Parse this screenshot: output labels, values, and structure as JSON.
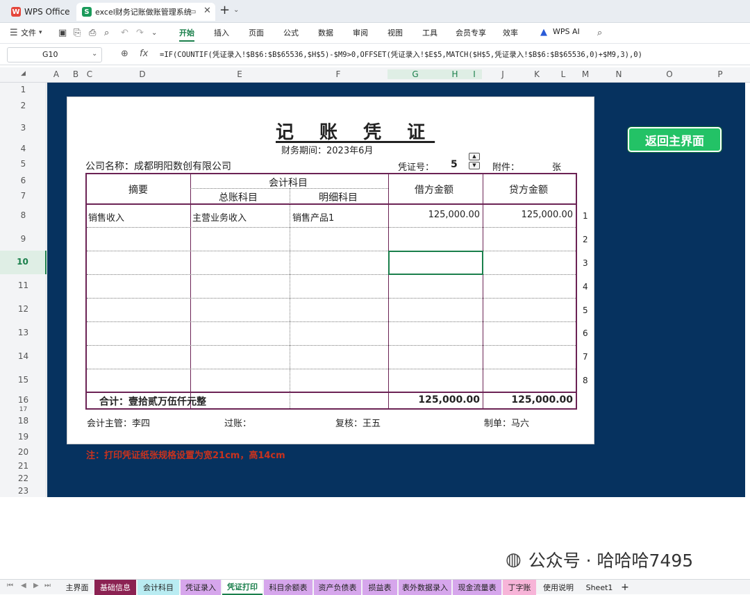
{
  "tabs": {
    "app": "WPS Office",
    "doc": "excel财务记账做账管理系统"
  },
  "menu": {
    "file": "文件",
    "items": [
      "开始",
      "插入",
      "页面",
      "公式",
      "数据",
      "审阅",
      "视图",
      "工具",
      "会员专享",
      "效率",
      "WPS AI"
    ]
  },
  "formula_bar": {
    "cell_ref": "G10",
    "fx": "fx",
    "formula": "=IF(COUNTIF(凭证录入!$B$6:$B$65536,$H$5)-$M9>0,OFFSET(凭证录入!$E$5,MATCH($H$5,凭证录入!$B$6:$B$65536,0)+$M9,3),0)"
  },
  "columns": [
    "A",
    "B",
    "C",
    "D",
    "E",
    "F",
    "G",
    "H",
    "I",
    "J",
    "K",
    "L",
    "M",
    "N",
    "O",
    "P"
  ],
  "rows": [
    "1",
    "2",
    "3",
    "4",
    "5",
    "6",
    "7",
    "8",
    "9",
    "10",
    "11",
    "12",
    "13",
    "14",
    "15",
    "16",
    "17",
    "18",
    "19",
    "20",
    "21",
    "22",
    "23"
  ],
  "voucher": {
    "title": "记 账 凭 证",
    "period": "财务期间：2023年6月",
    "company": "公司名称：成都明阳数创有限公司",
    "voucher_no_label": "凭证号：",
    "voucher_no": "5",
    "attach_label": "附件：",
    "attach_unit": "张",
    "headers": {
      "summary": "摘要",
      "subject": "会计科目",
      "general": "总账科目",
      "detail": "明细科目",
      "debit": "借方金额",
      "credit": "贷方金额"
    },
    "rows": [
      {
        "summary": "销售收入",
        "general": "主营业务收入",
        "detail": "销售产品1",
        "debit": "125,000.00",
        "credit": "125,000.00"
      },
      {
        "summary": "",
        "general": "",
        "detail": "",
        "debit": "",
        "credit": ""
      },
      {
        "summary": "",
        "general": "",
        "detail": "",
        "debit": "",
        "credit": ""
      },
      {
        "summary": "",
        "general": "",
        "detail": "",
        "debit": "",
        "credit": ""
      },
      {
        "summary": "",
        "general": "",
        "detail": "",
        "debit": "",
        "credit": ""
      },
      {
        "summary": "",
        "general": "",
        "detail": "",
        "debit": "",
        "credit": ""
      },
      {
        "summary": "",
        "general": "",
        "detail": "",
        "debit": "",
        "credit": ""
      },
      {
        "summary": "",
        "general": "",
        "detail": "",
        "debit": "",
        "credit": ""
      }
    ],
    "row_numbers": [
      "1",
      "2",
      "3",
      "4",
      "5",
      "6",
      "7",
      "8"
    ],
    "total_label": "合计：壹拾贰万伍仟元整",
    "total_debit": "125,000.00",
    "total_credit": "125,000.00",
    "supervisor": "会计主管：李四",
    "posting": "过账：",
    "review": "复核：王五",
    "maker": "制单：马六"
  },
  "return_button": "返回主界面",
  "note": "注：打印凭证纸张规格设置为宽21cm，高14cm",
  "sheet_tabs": [
    "主界面",
    "基础信息",
    "会计科目",
    "凭证录入",
    "凭证打印",
    "科目余额表",
    "资产负债表",
    "损益表",
    "表外数据录入",
    "现金流量表",
    "丁字账",
    "使用说明",
    "Sheet1"
  ],
  "watermark": "公众号 · 哈哈哈7495"
}
